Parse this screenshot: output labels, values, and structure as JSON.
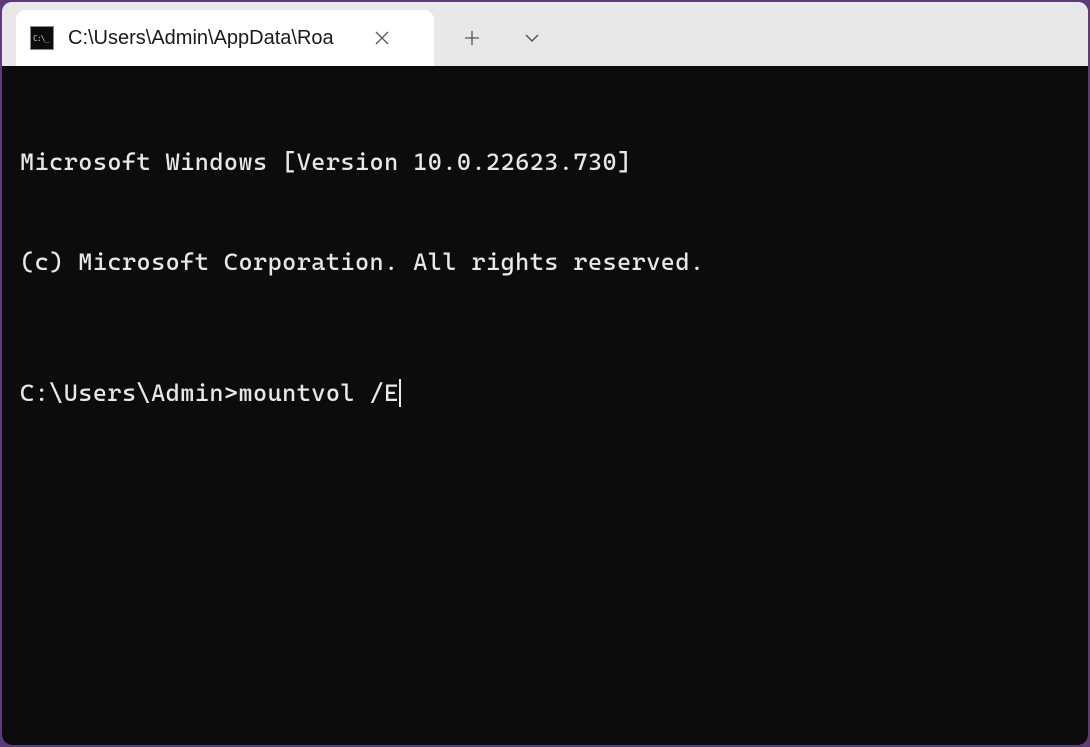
{
  "tab": {
    "title": "C:\\Users\\Admin\\AppData\\Roa",
    "icon_label": "cmd-icon"
  },
  "terminal": {
    "line1": "Microsoft Windows [Version 10.0.22623.730]",
    "line2": "(c) Microsoft Corporation. All rights reserved.",
    "prompt": "C:\\Users\\Admin>",
    "command": "mountvol /E"
  },
  "colors": {
    "window_border": "#5e3a7a",
    "tabbar_bg": "#e8e8e8",
    "tab_active_bg": "#ffffff",
    "terminal_bg": "#0c0c0c",
    "terminal_fg": "#e8e8e8"
  }
}
